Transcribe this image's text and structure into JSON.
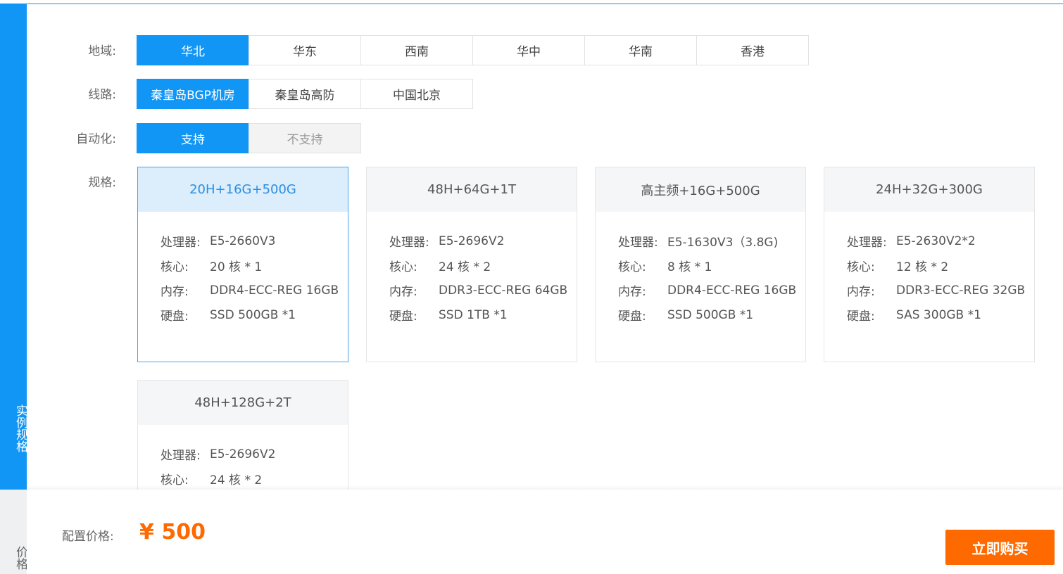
{
  "side_tabs": {
    "spec": "实例规格",
    "price": "价格"
  },
  "region": {
    "label": "地域:",
    "options": [
      "华北",
      "华东",
      "西南",
      "华中",
      "华南",
      "香港"
    ],
    "selected": "华北"
  },
  "line": {
    "label": "线路:",
    "options": [
      "秦皇岛BGP机房",
      "秦皇岛高防",
      "中国北京"
    ],
    "selected": "秦皇岛BGP机房"
  },
  "automation": {
    "label": "自动化:",
    "options": [
      "支持",
      "不支持"
    ],
    "selected": "支持"
  },
  "spec": {
    "label": "规格:",
    "field_labels": {
      "cpu": "处理器:",
      "cores": "核心:",
      "memory": "内存:",
      "disk": "硬盘:"
    },
    "cards": [
      {
        "title": "20H+16G+500G",
        "cpu": "E5-2660V3",
        "cores": "20 核 * 1",
        "memory": "DDR4-ECC-REG 16GB",
        "disk": "SSD 500GB *1",
        "selected": true
      },
      {
        "title": "48H+64G+1T",
        "cpu": "E5-2696V2",
        "cores": "24 核 * 2",
        "memory": "DDR3-ECC-REG 64GB",
        "disk": "SSD 1TB *1",
        "selected": false
      },
      {
        "title": "高主频+16G+500G",
        "cpu": "E5-1630V3（3.8G)",
        "cores": "8 核 * 1",
        "memory": "DDR4-ECC-REG 16GB",
        "disk": "SSD 500GB *1",
        "selected": false
      },
      {
        "title": "24H+32G+300G",
        "cpu": "E5-2630V2*2",
        "cores": "12 核 * 2",
        "memory": "DDR3-ECC-REG 32GB",
        "disk": "SAS 300GB *1",
        "selected": false
      },
      {
        "title": "48H+128G+2T",
        "cpu": "E5-2696V2",
        "cores": "24 核 * 2",
        "memory": "",
        "disk": "",
        "selected": false
      }
    ]
  },
  "price": {
    "label": "配置价格:",
    "value": "¥ 500"
  },
  "buy_button": "立即购买",
  "colors": {
    "accent": "#1196f5",
    "price": "#fe6a00",
    "selected_card_header": "#dcedfc"
  }
}
